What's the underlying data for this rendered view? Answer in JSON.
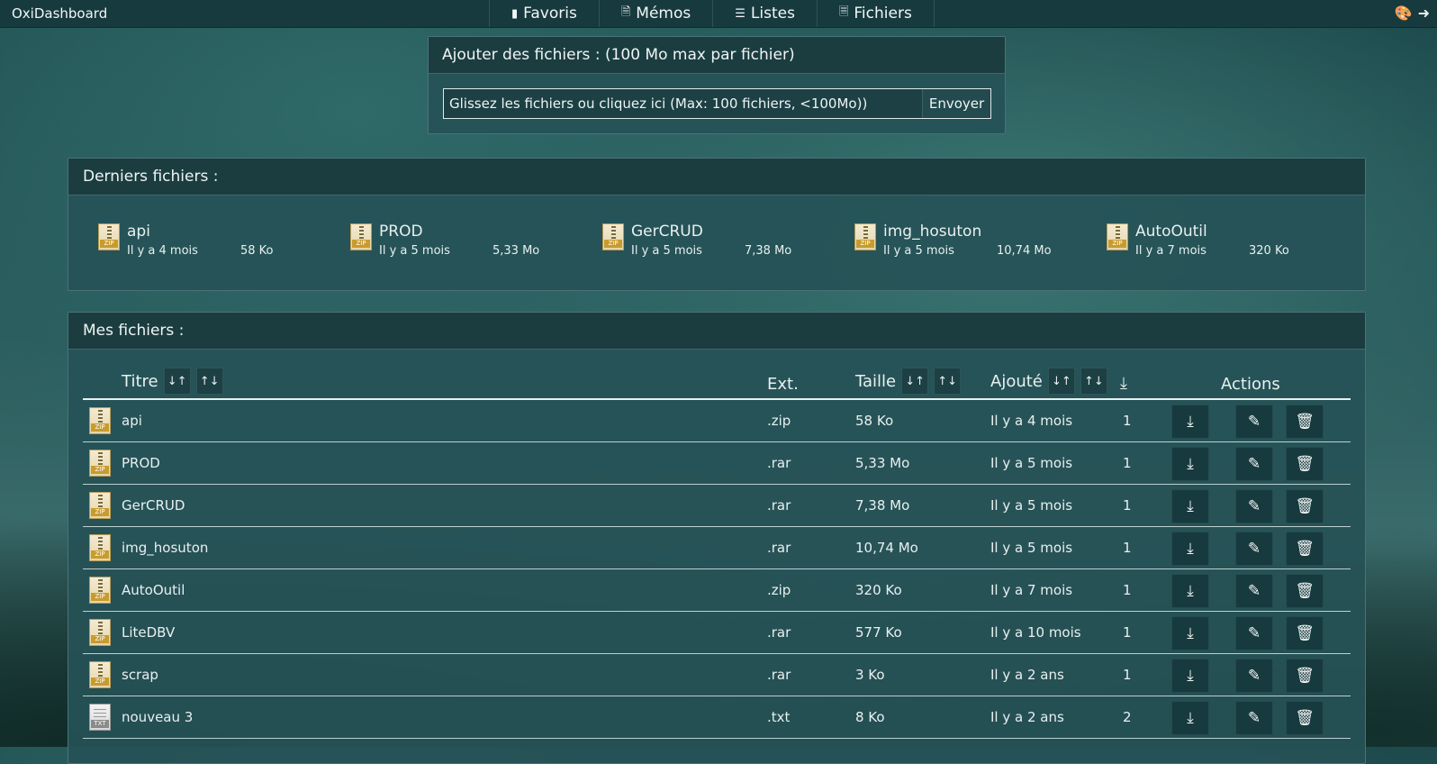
{
  "app": {
    "brand": "OxiDashboard"
  },
  "nav": [
    {
      "label": "Favoris",
      "icon": "bookmark-icon"
    },
    {
      "label": "Mémos",
      "icon": "document-icon"
    },
    {
      "label": "Listes",
      "icon": "list-icon"
    },
    {
      "label": "Fichiers",
      "icon": "file-icon"
    }
  ],
  "upload": {
    "title": "Ajouter des fichiers : (100 Mo max par fichier)",
    "placeholder": "Glissez les fichiers ou cliquez ici (Max: 100 fichiers, <100Mo))",
    "button": "Envoyer"
  },
  "recent": {
    "title": "Derniers fichiers :",
    "items": [
      {
        "name": "api",
        "age": "Il y a 4 mois",
        "size": "58 Ko",
        "icon": "ZIP"
      },
      {
        "name": "PROD",
        "age": "Il y a 5 mois",
        "size": "5,33 Mo",
        "icon": "ZIP"
      },
      {
        "name": "GerCRUD",
        "age": "Il y a 5 mois",
        "size": "7,38 Mo",
        "icon": "ZIP"
      },
      {
        "name": "img_hosuton",
        "age": "Il y a 5 mois",
        "size": "10,74 Mo",
        "icon": "ZIP"
      },
      {
        "name": "AutoOutil",
        "age": "Il y a 7 mois",
        "size": "320 Ko",
        "icon": "ZIP"
      }
    ]
  },
  "files": {
    "title": "Mes fichiers :",
    "columns": {
      "title": "Titre",
      "ext": "Ext.",
      "size": "Taille",
      "added": "Ajouté",
      "actions": "Actions"
    },
    "rows": [
      {
        "title": "api",
        "ext": ".zip",
        "size": "58 Ko",
        "added": "Il y a 4 mois",
        "downloads": "1",
        "icon": "ZIP"
      },
      {
        "title": "PROD",
        "ext": ".rar",
        "size": "5,33 Mo",
        "added": "Il y a 5 mois",
        "downloads": "1",
        "icon": "ZIP"
      },
      {
        "title": "GerCRUD",
        "ext": ".rar",
        "size": "7,38 Mo",
        "added": "Il y a 5 mois",
        "downloads": "1",
        "icon": "ZIP"
      },
      {
        "title": "img_hosuton",
        "ext": ".rar",
        "size": "10,74 Mo",
        "added": "Il y a 5 mois",
        "downloads": "1",
        "icon": "ZIP"
      },
      {
        "title": "AutoOutil",
        "ext": ".zip",
        "size": "320 Ko",
        "added": "Il y a 7 mois",
        "downloads": "1",
        "icon": "ZIP"
      },
      {
        "title": "LiteDBV",
        "ext": ".rar",
        "size": "577 Ko",
        "added": "Il y a 10 mois",
        "downloads": "1",
        "icon": "ZIP"
      },
      {
        "title": "scrap",
        "ext": ".rar",
        "size": "3 Ko",
        "added": "Il y a 2 ans",
        "downloads": "1",
        "icon": "ZIP"
      },
      {
        "title": "nouveau 3",
        "ext": ".txt",
        "size": "8 Ko",
        "added": "Il y a 2 ans",
        "downloads": "2",
        "icon": "TXT"
      }
    ]
  }
}
